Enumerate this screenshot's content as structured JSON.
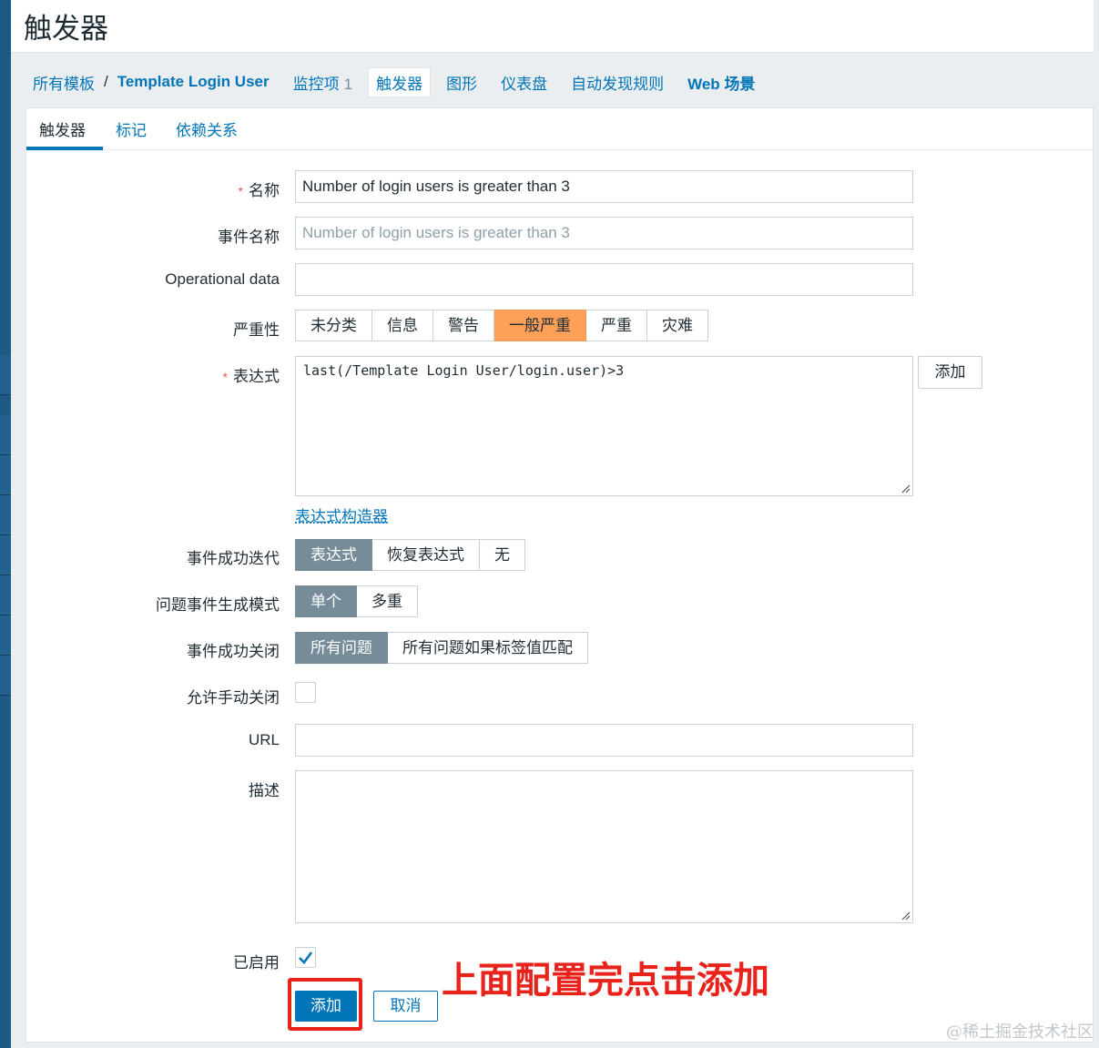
{
  "page": {
    "title": "触发器"
  },
  "nav": {
    "breadcrumb_root": "所有模板",
    "breadcrumb_sep": "/",
    "breadcrumb_current": "Template Login User",
    "items_label": "监控项",
    "items_count": "1",
    "triggers_label": "触发器",
    "graphs_label": "图形",
    "dashboards_label": "仪表盘",
    "discovery_label": "自动发现规则",
    "web_label": "Web 场景"
  },
  "subtabs": {
    "trigger": "触发器",
    "tags": "标记",
    "dependencies": "依赖关系"
  },
  "form": {
    "name_label": "名称",
    "name_value": "Number of login users is greater than 3",
    "event_name_label": "事件名称",
    "event_name_placeholder": "Number of login users is greater than 3",
    "opdata_label": "Operational data",
    "opdata_value": "",
    "severity_label": "严重性",
    "severity_options": [
      "未分类",
      "信息",
      "警告",
      "一般严重",
      "严重",
      "灾难"
    ],
    "severity_selected": "一般严重",
    "expression_label": "表达式",
    "expression_value": "last(/Template Login User/login.user)>3",
    "add_button": "添加",
    "expression_builder_link": "表达式构造器",
    "ok_event_gen_label": "事件成功迭代",
    "ok_event_gen_options": [
      "表达式",
      "恢复表达式",
      "无"
    ],
    "ok_event_gen_selected": "表达式",
    "problem_mode_label": "问题事件生成模式",
    "problem_mode_options": [
      "单个",
      "多重"
    ],
    "problem_mode_selected": "单个",
    "ok_close_label": "事件成功关闭",
    "ok_close_options": [
      "所有问题",
      "所有问题如果标签值匹配"
    ],
    "ok_close_selected": "所有问题",
    "manual_close_label": "允许手动关闭",
    "manual_close_checked": false,
    "url_label": "URL",
    "url_value": "",
    "description_label": "描述",
    "description_value": "",
    "enabled_label": "已启用",
    "enabled_checked": true
  },
  "actions": {
    "submit": "添加",
    "cancel": "取消"
  },
  "annotation": {
    "text": "上面配置完点击添加",
    "color": "#e8231c"
  },
  "watermark": "@稀土掘金技术社区",
  "colors": {
    "accent": "#0275b8",
    "severity_average": "#ffa059",
    "selected_gray": "#768d99"
  }
}
